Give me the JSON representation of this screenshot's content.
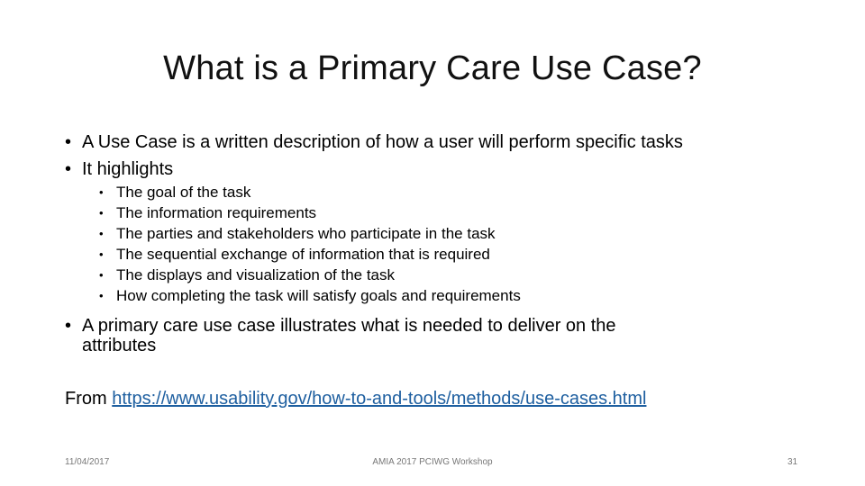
{
  "slide": {
    "title": "What is a Primary Care Use Case?",
    "bullets": [
      "A Use Case is a written description of how a user will perform specific tasks",
      "It highlights"
    ],
    "sub_bullets": [
      "The goal of the task",
      "The information requirements",
      "The parties and stakeholders who participate in the task",
      "The sequential exchange of information that is required",
      "The displays and visualization of the task",
      "How completing the task will satisfy goals and requirements"
    ],
    "bullet3_line1": "A primary care use case illustrates what is needed to deliver on the",
    "bullet3_line2": "attributes",
    "source_prefix": "From",
    "source_link": "https://www.usability.gov/how-to-and-tools/methods/use-cases.html",
    "bullet_glyph": "•"
  },
  "footer": {
    "date": "11/04/2017",
    "center": "AMIA 2017 PCIWG Workshop",
    "page": "31"
  },
  "colors": {
    "link": "#1e5fa0",
    "footer": "#777777"
  }
}
